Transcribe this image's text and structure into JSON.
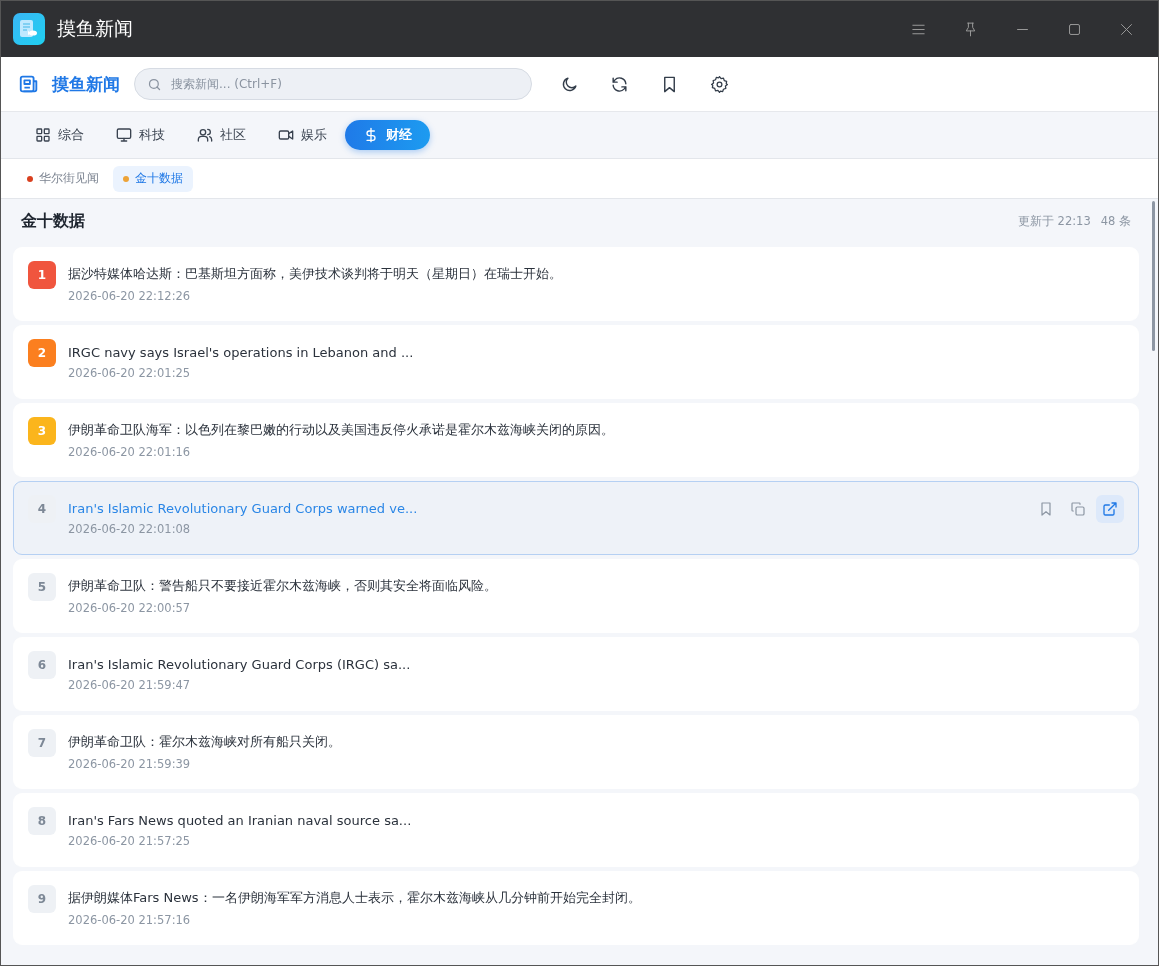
{
  "window": {
    "title": "摸鱼新闻"
  },
  "header": {
    "brand": "摸鱼新闻",
    "search": {
      "placeholder": "搜索新闻... (Ctrl+F)"
    }
  },
  "tabs": [
    {
      "label": "综合",
      "selected": false
    },
    {
      "label": "科技",
      "selected": false
    },
    {
      "label": "社区",
      "selected": false
    },
    {
      "label": "娱乐",
      "selected": false
    },
    {
      "label": "财经",
      "selected": true
    }
  ],
  "sources": [
    {
      "label": "华尔街见闻",
      "color": "#d9401f",
      "selected": false
    },
    {
      "label": "金十数据",
      "color": "#eda338",
      "selected": true
    }
  ],
  "feed": {
    "title": "金十数据",
    "updated": "更新于 22:13",
    "count": "48 条",
    "items": [
      {
        "rank": "1",
        "color": "#f0553e",
        "title": "据沙特媒体哈达斯：巴基斯坦方面称，美伊技术谈判将于明天（星期日）在瑞士开始。",
        "time": "2026-06-20 22:12:26",
        "selected": false
      },
      {
        "rank": "2",
        "color": "#fb7f1f",
        "title": "IRGC navy says Israel's operations in Lebanon and ...",
        "time": "2026-06-20 22:01:25",
        "selected": false
      },
      {
        "rank": "3",
        "color": "#fbb51c",
        "title": "伊朗革命卫队海军：以色列在黎巴嫩的行动以及美国违反停火承诺是霍尔木兹海峡关闭的原因。",
        "time": "2026-06-20 22:01:16",
        "selected": false
      },
      {
        "rank": "4",
        "title": "Iran's Islamic Revolutionary Guard Corps warned ve...",
        "time": "2026-06-20 22:01:08",
        "selected": true
      },
      {
        "rank": "5",
        "title": "伊朗革命卫队：警告船只不要接近霍尔木兹海峡，否则其安全将面临风险。",
        "time": "2026-06-20 22:00:57",
        "selected": false
      },
      {
        "rank": "6",
        "title": "Iran's Islamic Revolutionary Guard Corps (IRGC) sa...",
        "time": "2026-06-20 21:59:47",
        "selected": false
      },
      {
        "rank": "7",
        "title": "伊朗革命卫队：霍尔木兹海峡对所有船只关闭。",
        "time": "2026-06-20 21:59:39",
        "selected": false
      },
      {
        "rank": "8",
        "title": "Iran's Fars News quoted an Iranian naval source sa...",
        "time": "2026-06-20 21:57:25",
        "selected": false
      },
      {
        "rank": "9",
        "title": "据伊朗媒体Fars News：一名伊朗海军军方消息人士表示，霍尔木兹海峡从几分钟前开始完全封闭。",
        "time": "2026-06-20 21:57:16",
        "selected": false
      }
    ]
  }
}
